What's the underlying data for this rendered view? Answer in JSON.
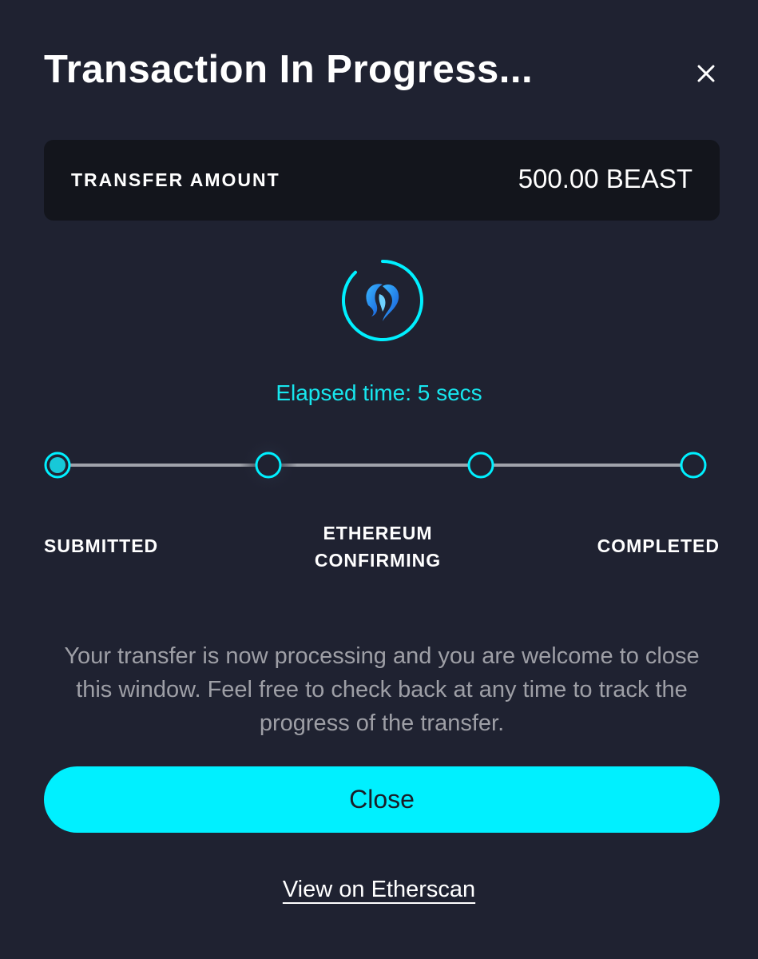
{
  "dialog": {
    "title": "Transaction In Progress...",
    "close_icon": "close-icon"
  },
  "transfer": {
    "label": "TRANSFER AMOUNT",
    "amount": "500.00 BEAST"
  },
  "token_logo_icon": "token-spinner-icon",
  "elapsed": {
    "text": "Elapsed time: 5 secs"
  },
  "progress": {
    "current_step": 2,
    "steps": [
      {
        "label": "SUBMITTED",
        "state": "done"
      },
      {
        "label": "ETHEREUM CONFIRMING",
        "state": "active"
      },
      {
        "label": "",
        "state": "pending"
      },
      {
        "label": "COMPLETED",
        "state": "pending"
      }
    ]
  },
  "message": "Your transfer is now processing and you are welcome to close this window. Feel free to check back at any time to track the progress of the transfer.",
  "buttons": {
    "close_label": "Close"
  },
  "links": {
    "etherscan_label": "View on Etherscan"
  },
  "colors": {
    "background": "#1f2231",
    "panel": "#13151c",
    "accent": "#00f0ff",
    "accent_text": "#17e6ee",
    "progress_fill": "#1e90ff",
    "track": "#a0a3ab",
    "muted_text": "#9e9fa6"
  }
}
